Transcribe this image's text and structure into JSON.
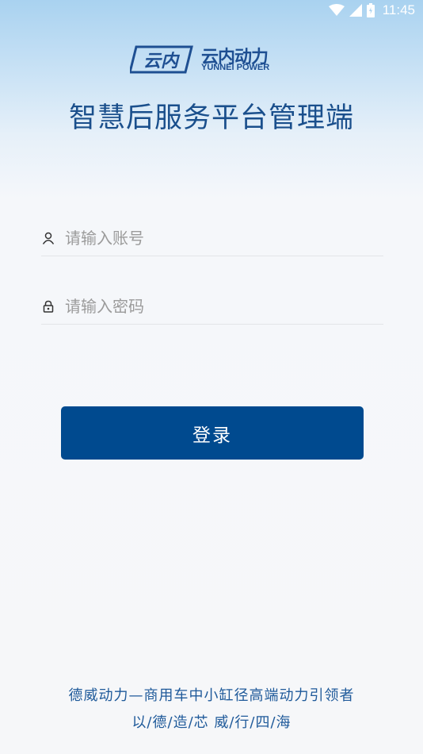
{
  "status_bar": {
    "time": "11:45",
    "icons": [
      "wifi-icon",
      "cellular-signal-icon",
      "battery-icon"
    ]
  },
  "logo": {
    "mark": "云内",
    "brand_cn": "云内动力",
    "brand_en": "YUNNEI POWER"
  },
  "header": {
    "title": "智慧后服务平台管理端"
  },
  "form": {
    "account_placeholder": "请输入账号",
    "password_placeholder": "请输入密码",
    "login_label": "登录"
  },
  "footer": {
    "line1": "德威动力—商用车中小缸径高端动力引领者",
    "line2": "以/德/造/芯 威/行/四/海"
  },
  "colors": {
    "primary": "#004a8f",
    "title": "#1a4f8c"
  }
}
